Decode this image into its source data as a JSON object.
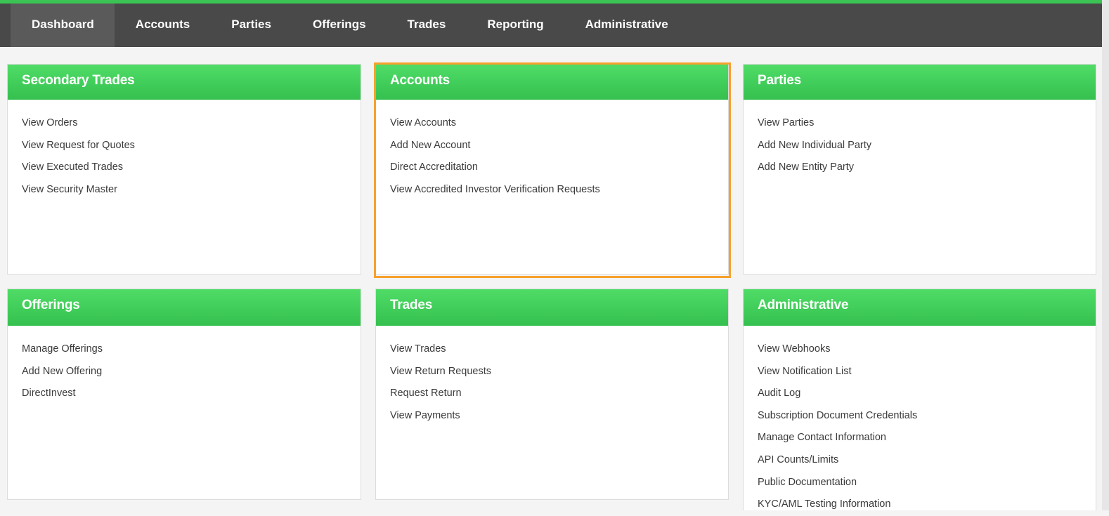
{
  "nav": {
    "items": [
      {
        "label": "Dashboard",
        "active": true
      },
      {
        "label": "Accounts"
      },
      {
        "label": "Parties"
      },
      {
        "label": "Offerings"
      },
      {
        "label": "Trades"
      },
      {
        "label": "Reporting"
      },
      {
        "label": "Administrative"
      }
    ]
  },
  "colors": {
    "accent_green": "#3bc454",
    "nav_background": "#494949",
    "highlight_border": "#f7a12d"
  },
  "cards": {
    "secondary_trades": {
      "title": "Secondary Trades",
      "links": [
        "View Orders",
        "View Request for Quotes",
        "View Executed Trades",
        "View Security Master"
      ]
    },
    "accounts": {
      "title": "Accounts",
      "links": [
        "View Accounts",
        "Add New Account",
        "Direct Accreditation",
        "View Accredited Investor Verification Requests"
      ]
    },
    "parties": {
      "title": "Parties",
      "links": [
        "View Parties",
        "Add New Individual Party",
        "Add New Entity Party"
      ]
    },
    "offerings": {
      "title": "Offerings",
      "links": [
        "Manage Offerings",
        "Add New Offering",
        "DirectInvest"
      ]
    },
    "trades": {
      "title": "Trades",
      "links": [
        "View Trades",
        "View Return Requests",
        "Request Return",
        "View Payments"
      ]
    },
    "administrative": {
      "title": "Administrative",
      "links": [
        "View Webhooks",
        "View Notification List",
        "Audit Log",
        "Subscription Document Credentials",
        "Manage Contact Information",
        "API Counts/Limits",
        "Public Documentation",
        "KYC/AML Testing Information"
      ]
    }
  }
}
